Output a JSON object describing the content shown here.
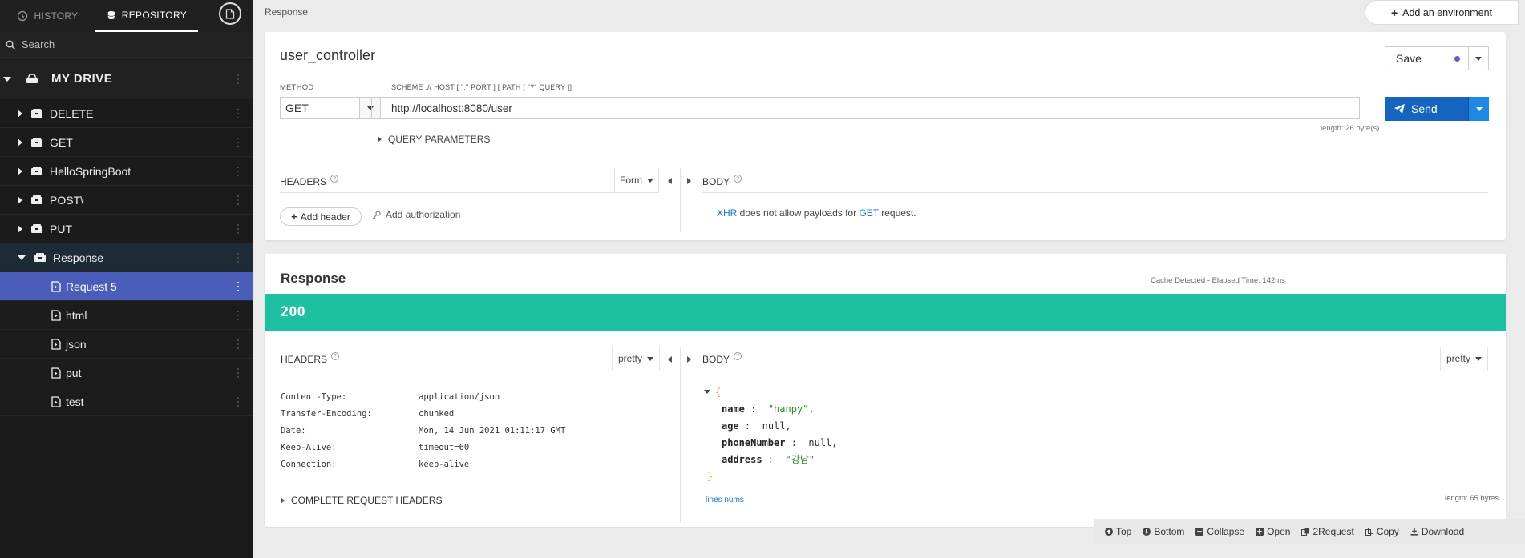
{
  "sidebar": {
    "tabs": {
      "history": "HISTORY",
      "repository": "REPOSITORY"
    },
    "search_label": "Search",
    "drive_label": "MY DRIVE",
    "folders": [
      {
        "label": "DELETE"
      },
      {
        "label": "GET"
      },
      {
        "label": "HelloSpringBoot"
      },
      {
        "label": "POST\\"
      },
      {
        "label": "PUT"
      },
      {
        "label": "Response"
      }
    ],
    "requests": [
      {
        "label": "Request 5"
      },
      {
        "label": "html"
      },
      {
        "label": "json"
      },
      {
        "label": "put"
      },
      {
        "label": "test"
      }
    ]
  },
  "header": {
    "breadcrumb": "Response",
    "add_environment": "Add an environment"
  },
  "request": {
    "title": "user_controller",
    "save_label": "Save",
    "method_label": "METHOD",
    "method_value": "GET",
    "url_label": "SCHEME :// HOST [ \":\" PORT ] [ PATH [ \"?\" QUERY ]]",
    "url_value": "http://localhost:8080/user",
    "send_label": "Send",
    "length_note": "length: 26 byte(s)",
    "query_params": "QUERY PARAMETERS",
    "headers_label": "HEADERS",
    "form_label": "Form",
    "body_label": "BODY",
    "add_header": "Add header",
    "add_authorization": "Add authorization",
    "body_note": {
      "xhr": "XHR",
      "text1": " does not allow payloads for ",
      "get": "GET",
      "text2": " request."
    }
  },
  "response": {
    "title": "Response",
    "cache_note": "Cache Detected - Elapsed Time: 142ms",
    "status_code": "200",
    "headers_label": "HEADERS",
    "pretty_label": "pretty",
    "body_label": "BODY",
    "headers": [
      {
        "key": "Content-Type:",
        "value": "application/json"
      },
      {
        "key": "Transfer-Encoding:",
        "value": "chunked"
      },
      {
        "key": "Date:",
        "value": "Mon, 14 Jun 2021 01:11:17 GMT"
      },
      {
        "key": "Keep-Alive:",
        "value": "timeout=60"
      },
      {
        "key": "Connection:",
        "value": "keep-alive"
      }
    ],
    "complete_headers": "COMPLETE REQUEST HEADERS",
    "json": {
      "open": "{",
      "close": "}",
      "fields": [
        {
          "key": "name",
          "value": "\"hanpy\"",
          "sep": ",",
          "type": "string"
        },
        {
          "key": "age",
          "value": "null",
          "sep": ",",
          "type": "null"
        },
        {
          "key": "phoneNumber",
          "value": "null",
          "sep": ",",
          "type": "null"
        },
        {
          "key": "address",
          "value": "\"강남\"",
          "sep": "",
          "type": "string"
        }
      ]
    },
    "lines_nums": "lines nums",
    "length_note": "length: 65 bytes"
  },
  "toolbar": {
    "items": [
      {
        "label": "Top",
        "icon": "arrow-up-circle-icon"
      },
      {
        "label": "Bottom",
        "icon": "arrow-down-circle-icon"
      },
      {
        "label": "Collapse",
        "icon": "minus-square-icon"
      },
      {
        "label": "Open",
        "icon": "plus-square-icon"
      },
      {
        "label": "2Request",
        "icon": "copy-request-icon"
      },
      {
        "label": "Copy",
        "icon": "clipboard-icon"
      },
      {
        "label": "Download",
        "icon": "download-icon"
      }
    ]
  },
  "colors": {
    "sidebar_bg": "#1b1b1b",
    "selected_row": "#4a5db8",
    "send_button": "#1565c0",
    "status_success": "#1dc0a0"
  }
}
